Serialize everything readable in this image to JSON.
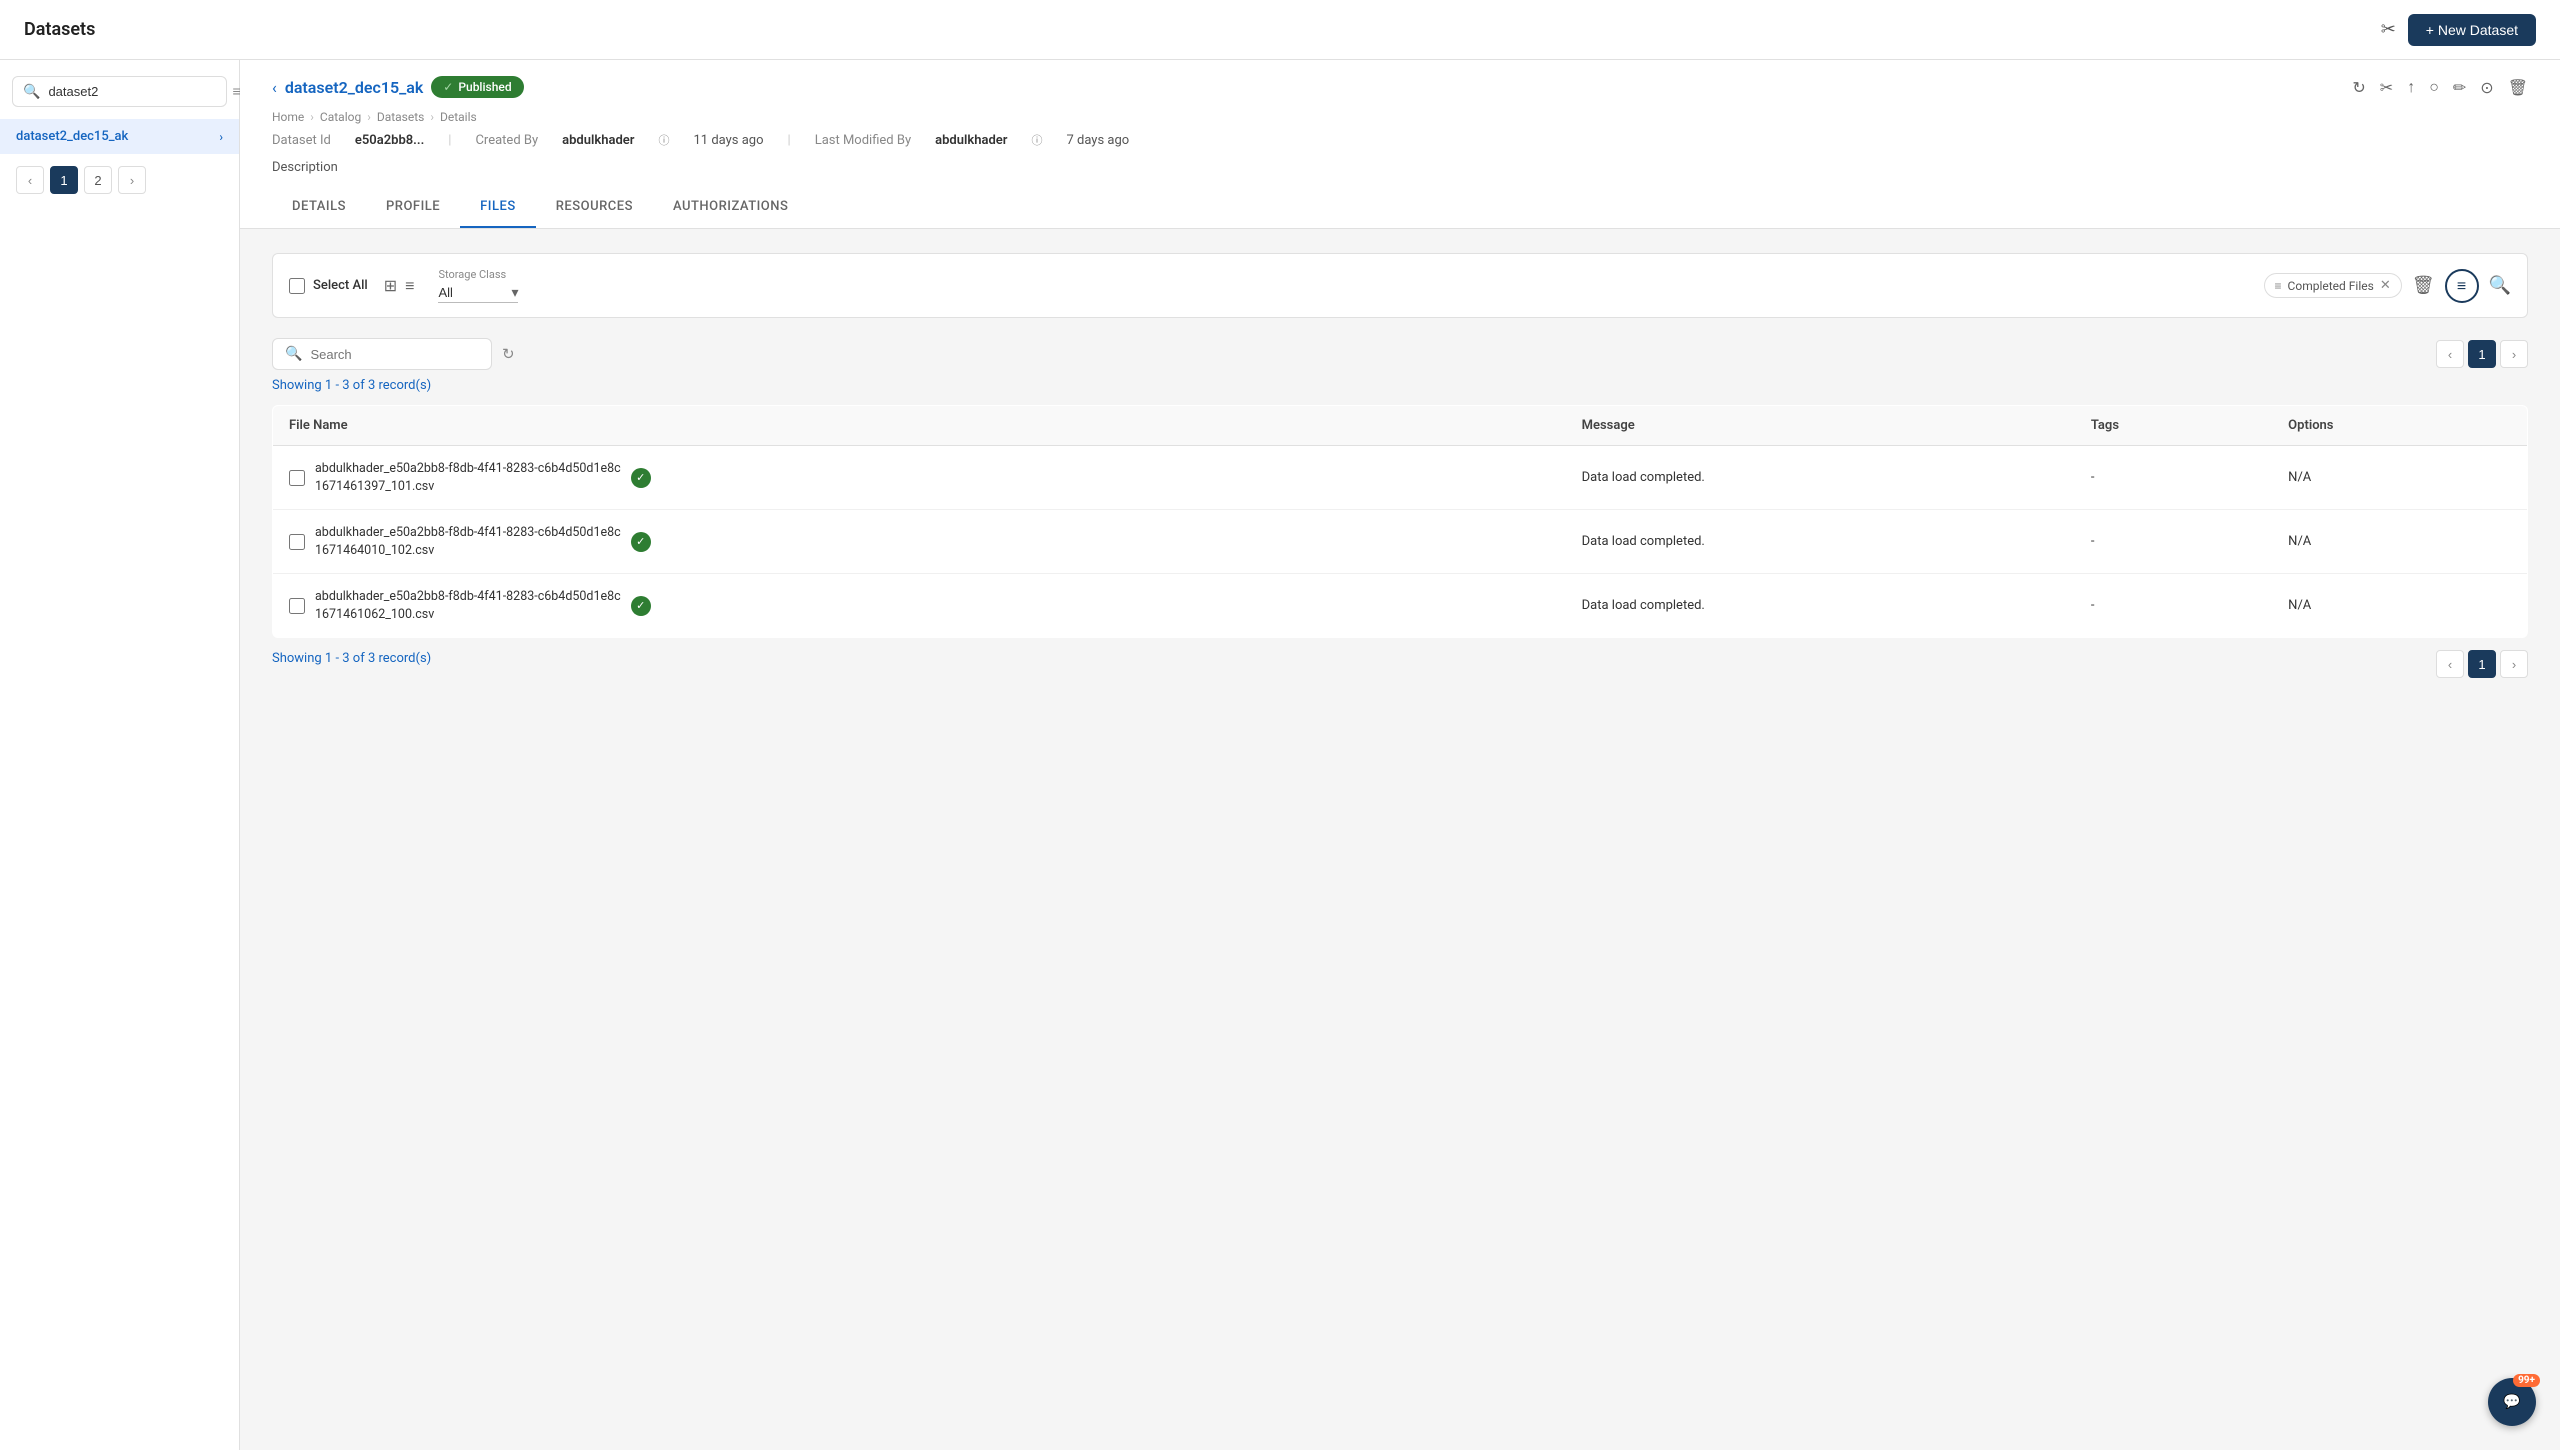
{
  "header": {
    "title": "Datasets",
    "new_dataset_label": "+ New Dataset"
  },
  "breadcrumb": {
    "items": [
      "Home",
      "Catalog",
      "Datasets",
      "Details"
    ]
  },
  "sidebar": {
    "search_placeholder": "dataset2",
    "search_value": "dataset2",
    "current_dataset": "dataset2_dec15_ak",
    "pages": [
      {
        "label": "1",
        "active": true
      },
      {
        "label": "2",
        "active": false
      }
    ]
  },
  "dataset": {
    "name": "dataset2_dec15_ak",
    "status": "Published",
    "id_label": "Dataset Id",
    "id_value": "e50a2bb8...",
    "created_by_label": "Created By",
    "created_by": "abdulkhader",
    "created_ago": "11 days ago",
    "modified_by_label": "Last Modified By",
    "modified_by": "abdulkhader",
    "modified_ago": "7 days ago",
    "description_label": "Description"
  },
  "tabs": [
    {
      "label": "DETAILS",
      "active": false
    },
    {
      "label": "PROFILE",
      "active": false
    },
    {
      "label": "FILES",
      "active": true
    },
    {
      "label": "RESOURCES",
      "active": false
    },
    {
      "label": "AUTHORIZATIONS",
      "active": false
    }
  ],
  "files": {
    "select_all_label": "Select All",
    "storage_class_label": "Storage Class",
    "storage_class_value": "All",
    "filter_badge": "Completed Files",
    "search_placeholder": "Search",
    "records_showing": "Showing 1 - 3 of 3 record(s)",
    "columns": [
      "File Name",
      "Message",
      "Tags",
      "Options"
    ],
    "rows": [
      {
        "filename": "abdulkhader_e50a2bb8-f8db-4f41-8283-c6b4d50d1e8c_1671461397_101.csv",
        "status": "completed",
        "message": "Data load completed.",
        "tags": "-",
        "options": "N/A"
      },
      {
        "filename": "abdulkhader_e50a2bb8-f8db-4f41-8283-c6b4d50d1e8c_1671464010_102.csv",
        "status": "completed",
        "message": "Data load completed.",
        "tags": "-",
        "options": "N/A"
      },
      {
        "filename": "abdulkhader_e50a2bb8-f8db-4f41-8283-c6b4d50d1e8c_1671461062_100.csv",
        "status": "completed",
        "message": "Data load completed.",
        "tags": "-",
        "options": "N/A"
      }
    ],
    "current_page": "1",
    "bottom_records_showing": "Showing 1 - 3 of 3 record(s)"
  },
  "chat": {
    "badge": "99+"
  }
}
